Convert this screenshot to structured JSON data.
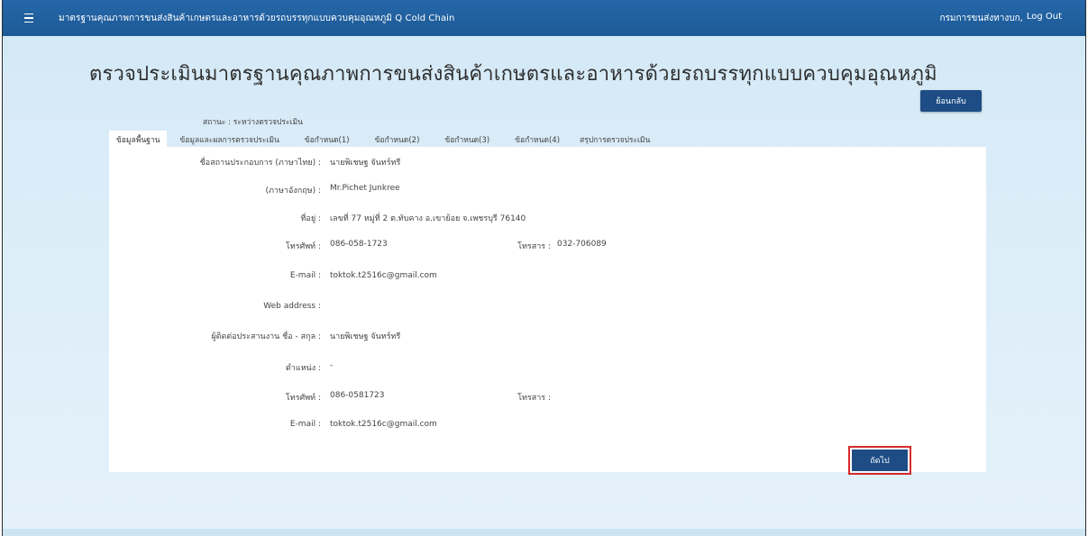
{
  "header": {
    "menu_icon": "hamburger-menu-icon",
    "app_title": "มาตรฐานคุณภาพการขนส่งสินค้าเกษตรและอาหารด้วยรถบรรทุกแบบควบคุมอุณหภูมิ Q Cold Chain",
    "user_name": "กรมการขนส่งทางบก,",
    "logout_label": "Log Out"
  },
  "page": {
    "title": "ตรวจประเมินมาตรฐานคุณภาพการขนส่งสินค้าเกษตรและอาหารด้วยรถบรรทุกแบบควบคุมอุณหภูมิ",
    "back_label": "ย้อนกลับ",
    "status_label": "สถานะ : ",
    "status_value": "ระหว่างตรวจประเมิน"
  },
  "tabs": [
    {
      "label": "ข้อมูลพื้นฐาน",
      "active": true
    },
    {
      "label": "ข้อมูลและผลการตรวจประเมิน",
      "active": false
    },
    {
      "label": "ข้อกำหนด(1)",
      "active": false
    },
    {
      "label": "ข้อกำหนด(2)",
      "active": false
    },
    {
      "label": "ข้อกำหนด(3)",
      "active": false
    },
    {
      "label": "ข้อกำหนด(4)",
      "active": false
    },
    {
      "label": "สรุปการตรวจประเมิน",
      "active": false
    }
  ],
  "form": {
    "name_th_label": "ชื่อสถานประกอบการ (ภาษาไทย) :",
    "name_th_value": "นายพิเชษฐ จันทร์ทรี",
    "name_en_label": "(ภาษาอังกฤษ) :",
    "name_en_value": "Mr.Pichet Junkree",
    "address_label": "ที่อยู่ :",
    "address_value": "เลขที่ 77 หมู่ที่ 2 ต.ทับคาง อ.เขาย้อย จ.เพชรบุรี 76140",
    "phone_label": "โทรศัพท์ :",
    "phone_value": "086-058-1723",
    "fax_label": "โทรสาร :",
    "fax_value": "032-706089",
    "email_label": "E-mail :",
    "email_value": "toktok.t2516c@gmail.com",
    "web_label": "Web address :",
    "web_value": "",
    "contact_label": "ผู้ติดต่อประสานงาน ชื่อ - สกุล :",
    "contact_value": "นายพิเชษฐ จันทร์ทรี",
    "position_label": "ตำแหน่ง :",
    "position_value": "-",
    "contact_phone_label": "โทรศัพท์ :",
    "contact_phone_value": "086-0581723",
    "contact_fax_label": "โทรสาร :",
    "contact_fax_value": "",
    "contact_email_label": "E-mail :",
    "contact_email_value": "toktok.t2516c@gmail.com"
  },
  "actions": {
    "next_label": "ถัดไป"
  },
  "colors": {
    "topbar": "#1d5a97",
    "button": "#1e4d86",
    "highlight": "#d62a2a",
    "background": "#d2e8f6"
  }
}
